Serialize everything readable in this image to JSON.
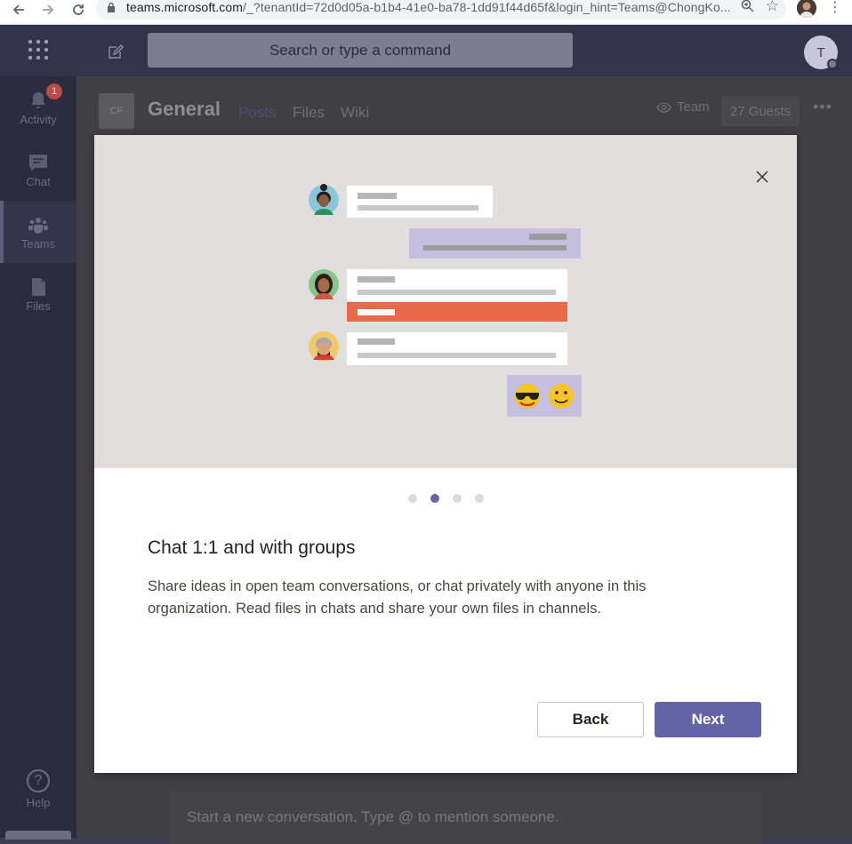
{
  "browser": {
    "url_main": "teams.microsoft.com",
    "url_rest": "/_?tenantId=72d0d05a-b1b4-41e0-ba78-1dd91f44d65f&login_hint=Teams@ChongKo..."
  },
  "header": {
    "search_placeholder": "Search or type a command",
    "user_initial": "T"
  },
  "rail": {
    "activity_label": "Activity",
    "activity_badge": "1",
    "chat_label": "Chat",
    "teams_label": "Teams",
    "files_label": "Files",
    "help_label": "Help"
  },
  "channel": {
    "tile_initials": "CF",
    "name": "General",
    "tabs": [
      "Posts",
      "Files",
      "Wiki"
    ],
    "team_label": "Team",
    "guests_label": "27 Guests",
    "compose_placeholder": "Start a new conversation. Type @ to mention someone."
  },
  "modal": {
    "title": "Chat 1:1 and with groups",
    "description": "Share ideas in open team conversations, or chat privately with anyone in this organization. Read files in chats and share your own files in channels.",
    "back_label": "Back",
    "next_label": "Next",
    "pages_total": 4,
    "page_current": 2
  },
  "colors": {
    "accent": "#6264a7",
    "hero_bg": "#e1dfdd",
    "bubble_purple": "#c5bfe0",
    "bubble_orange": "#e96a4a"
  }
}
